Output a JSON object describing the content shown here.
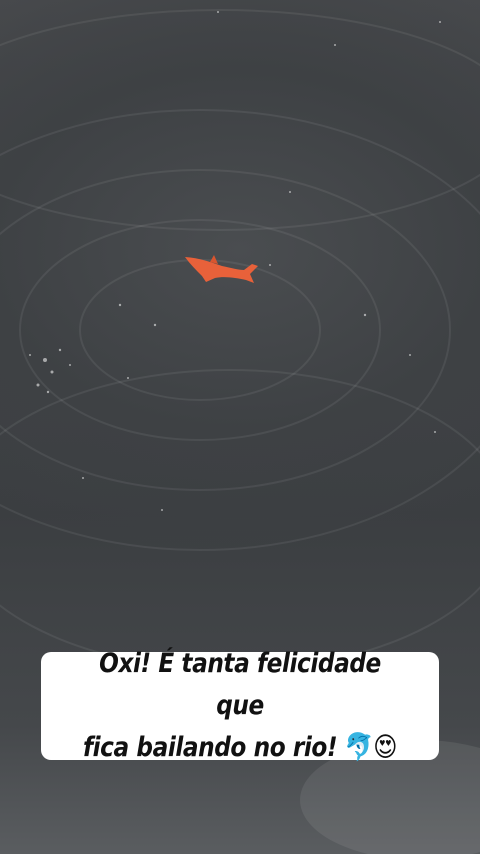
{
  "caption": {
    "line1": "Oxi! É tanta felicidade que",
    "line2": "fica bailando no rio!",
    "emojis": "🐬😍"
  },
  "colors": {
    "water": "#3f4245",
    "dolphin": "#e8613a",
    "caption_bg": "#ffffff",
    "caption_text": "#111111"
  }
}
